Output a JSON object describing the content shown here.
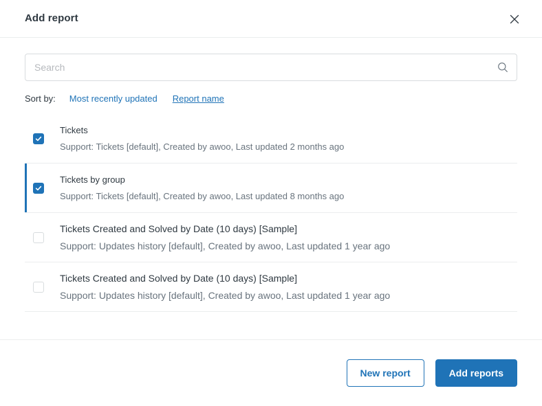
{
  "modal": {
    "title": "Add report",
    "close_icon": "close-icon"
  },
  "search": {
    "placeholder": "Search",
    "value": "",
    "icon": "search-icon"
  },
  "sort": {
    "label": "Sort by:",
    "options": [
      {
        "label": "Most recently updated",
        "active": true
      },
      {
        "label": "Report name",
        "active": false
      }
    ]
  },
  "reports": [
    {
      "title": "Tickets",
      "meta": "Support: Tickets [default], Created by awoo, Last updated 2 months ago",
      "checked": true,
      "focused": false,
      "large": false
    },
    {
      "title": "Tickets by group",
      "meta": "Support: Tickets [default], Created by awoo, Last updated 8 months ago",
      "checked": true,
      "focused": true,
      "large": false
    },
    {
      "title": "Tickets Created and Solved by Date (10 days) [Sample]",
      "meta": "Support: Updates history [default], Created by awoo, Last updated 1 year ago",
      "checked": false,
      "focused": false,
      "large": true
    },
    {
      "title": "Tickets Created and Solved by Date (10 days) [Sample]",
      "meta": "Support: Updates history [default], Created by awoo, Last updated 1 year ago",
      "checked": false,
      "focused": false,
      "large": true
    }
  ],
  "footer": {
    "new_report_label": "New report",
    "add_reports_label": "Add reports"
  },
  "colors": {
    "accent": "#1f73b7",
    "text_primary": "#2f3941",
    "text_secondary": "#68737d",
    "border": "#d8dcde",
    "divider": "#ebedee"
  }
}
